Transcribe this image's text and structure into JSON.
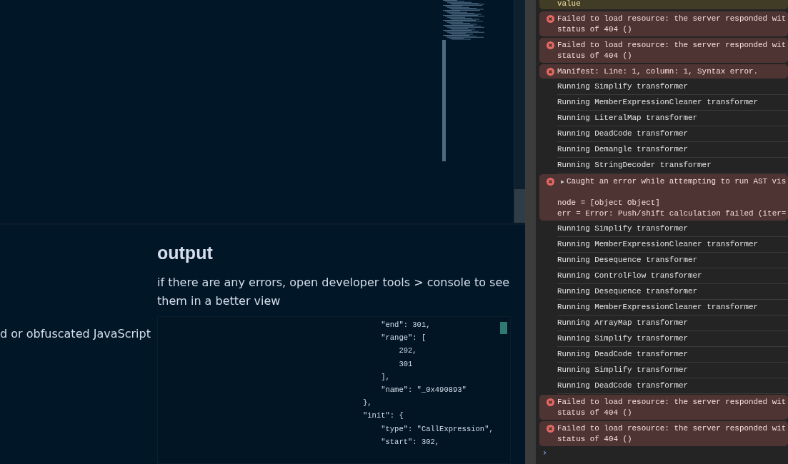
{
  "output": {
    "heading": "output",
    "hint": "if there are any errors, open developer tools > console to see them in a better view",
    "side_text": "d or obfuscated JavaScript",
    "code_lines": [
      "    \"end\": 301,",
      "    \"range\": [",
      "        292,",
      "        301",
      "    ],",
      "    \"name\": \"_0x490893\"",
      "},",
      "\"init\": {",
      "    \"type\": \"CallExpression\",",
      "    \"start\": 302,"
    ]
  },
  "console": {
    "messages": [
      {
        "kind": "warning",
        "text": "value"
      },
      {
        "kind": "error",
        "text": "Failed to load resource: the server responded wit\nstatus of 404 ()"
      },
      {
        "kind": "error",
        "text": "Failed to load resource: the server responded wit\nstatus of 404 ()"
      },
      {
        "kind": "error",
        "text": "Manifest: Line: 1, column: 1, Syntax error."
      },
      {
        "kind": "info",
        "text": "Running Simplify transformer"
      },
      {
        "kind": "info",
        "text": "Running MemberExpressionCleaner transformer"
      },
      {
        "kind": "info",
        "text": "Running LiteralMap transformer"
      },
      {
        "kind": "info",
        "text": "Running DeadCode transformer"
      },
      {
        "kind": "info",
        "text": "Running Demangle transformer"
      },
      {
        "kind": "info",
        "text": "Running StringDecoder transformer"
      },
      {
        "kind": "error",
        "toggle": "▶",
        "expanded": false,
        "text": "Caught an error while attempting to run AST vis\n\nnode = [object Object]\nerr = Error: Push/shift calculation failed (iter="
      },
      {
        "kind": "info",
        "text": "Running Simplify transformer"
      },
      {
        "kind": "info",
        "text": "Running MemberExpressionCleaner transformer"
      },
      {
        "kind": "info",
        "text": "Running Desequence transformer"
      },
      {
        "kind": "info",
        "text": "Running ControlFlow transformer"
      },
      {
        "kind": "info",
        "text": "Running Desequence transformer"
      },
      {
        "kind": "info",
        "text": "Running MemberExpressionCleaner transformer"
      },
      {
        "kind": "info",
        "text": "Running ArrayMap transformer"
      },
      {
        "kind": "info",
        "text": "Running Simplify transformer"
      },
      {
        "kind": "info",
        "text": "Running DeadCode transformer"
      },
      {
        "kind": "info",
        "text": "Running Simplify transformer"
      },
      {
        "kind": "info",
        "text": "Running DeadCode transformer"
      },
      {
        "kind": "error",
        "text": "Failed to load resource: the server responded wit\nstatus of 404 ()"
      },
      {
        "kind": "error",
        "text": "Failed to load resource: the server responded wit\nstatus of 404 ()"
      }
    ],
    "prompt": "›"
  }
}
